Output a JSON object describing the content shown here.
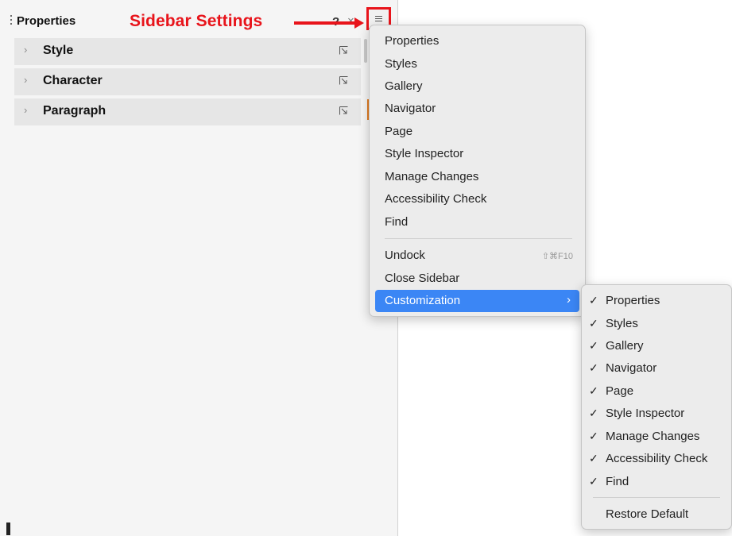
{
  "sidebar": {
    "title": "Properties",
    "help_label": "?",
    "close_label": "×",
    "panels": [
      {
        "label": "Style"
      },
      {
        "label": "Character"
      },
      {
        "label": "Paragraph"
      }
    ]
  },
  "annotation": {
    "label": "Sidebar Settings",
    "color": "#e8141b"
  },
  "menu": {
    "items": [
      {
        "label": "Properties"
      },
      {
        "label": "Styles"
      },
      {
        "label": "Gallery"
      },
      {
        "label": "Navigator"
      },
      {
        "label": "Page"
      },
      {
        "label": "Style Inspector"
      },
      {
        "label": "Manage Changes"
      },
      {
        "label": "Accessibility Check"
      },
      {
        "label": "Find"
      }
    ],
    "undock": {
      "label": "Undock",
      "shortcut": "⇧⌘F10"
    },
    "close_sidebar": {
      "label": "Close Sidebar"
    },
    "customization": {
      "label": "Customization",
      "arrow": "›"
    },
    "highlight_color": "#3b86f5"
  },
  "submenu": {
    "check": "✓",
    "items": [
      {
        "label": "Properties",
        "checked": true
      },
      {
        "label": "Styles",
        "checked": true
      },
      {
        "label": "Gallery",
        "checked": true
      },
      {
        "label": "Navigator",
        "checked": true
      },
      {
        "label": "Page",
        "checked": true
      },
      {
        "label": "Style Inspector",
        "checked": true
      },
      {
        "label": "Manage Changes",
        "checked": true
      },
      {
        "label": "Accessibility Check",
        "checked": true
      },
      {
        "label": "Find",
        "checked": true
      }
    ],
    "restore": {
      "label": "Restore Default"
    }
  }
}
